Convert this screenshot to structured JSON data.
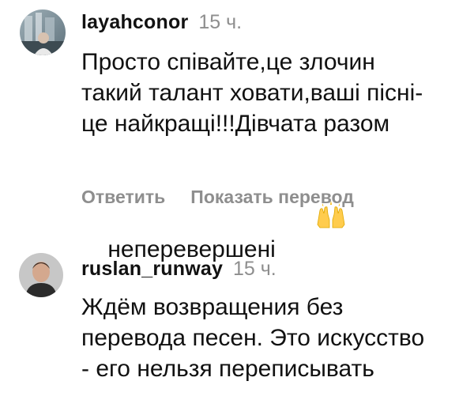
{
  "comments": [
    {
      "username": "layahconor",
      "time": "15 ч.",
      "lines": [
        "Просто співайте,це злочин",
        "такий талант ховати,ваші пісні-",
        "це найкращі!!!Дівчата разом",
        "неперевершені"
      ],
      "emoji": "raising-hands-emoji",
      "avatar": "avatar-photo-icon",
      "reply_label": "Ответить",
      "translate_label": "Показать перевод"
    },
    {
      "username": "ruslan_runway",
      "time": "15 ч.",
      "lines": [
        "Ждём возвращения без",
        "перевода песен. Это искусство",
        "- его нельзя переписывать"
      ],
      "avatar": "avatar-photo-icon"
    }
  ],
  "colors": {
    "text": "#111111",
    "muted": "#8e8e8e",
    "background": "#ffffff"
  }
}
